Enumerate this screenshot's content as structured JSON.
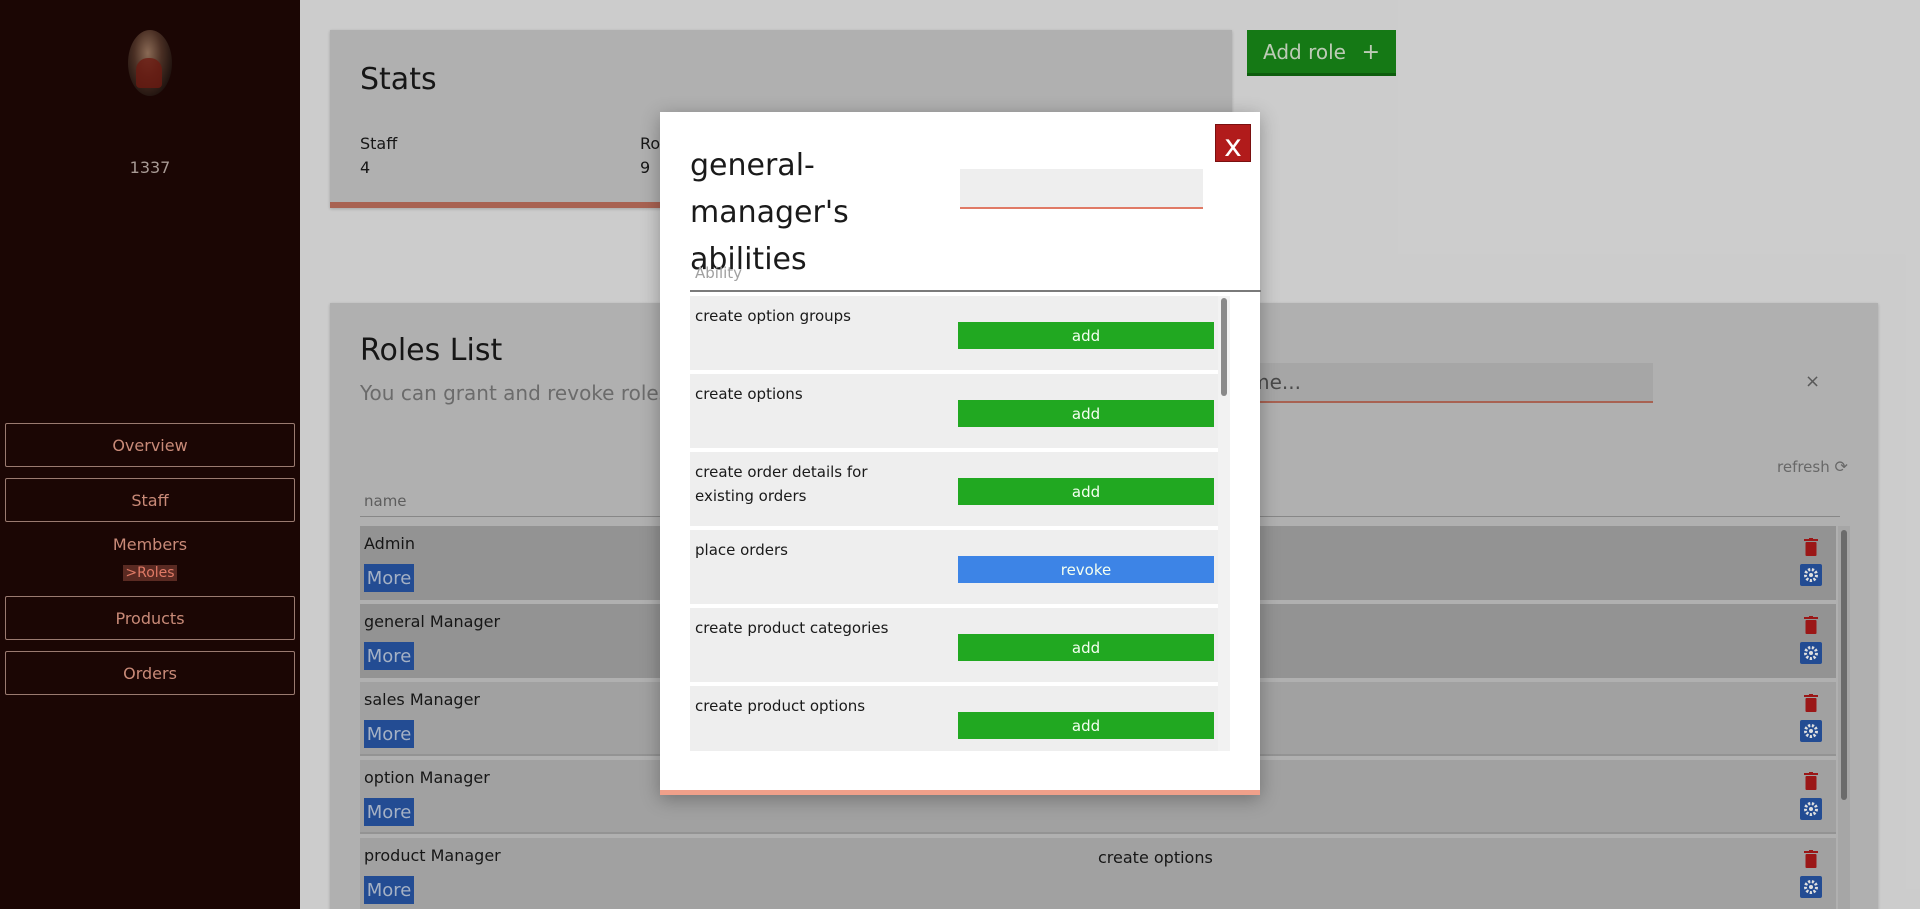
{
  "sidebar": {
    "user_id": "1337",
    "items": [
      {
        "label": "Overview"
      },
      {
        "label": "Staff"
      },
      {
        "label": "Members"
      },
      {
        "label": ">Roles"
      },
      {
        "label": "Products"
      },
      {
        "label": "Orders"
      }
    ]
  },
  "stats": {
    "title": "Stats",
    "items": [
      {
        "label": "Staff",
        "value": "4"
      },
      {
        "label": "Ro",
        "value": "9"
      }
    ]
  },
  "add_role": {
    "label": "Add role",
    "icon": "+"
  },
  "roles": {
    "title": "Roles List",
    "subtitle": "You can grant and revoke roles t",
    "search_placeholder": "ct name...",
    "clear": "×",
    "refresh_label": "refresh",
    "column_name": "name",
    "more_label": "More",
    "rows": [
      {
        "name": "Admin",
        "perm": ""
      },
      {
        "name": "general Manager",
        "perm": ""
      },
      {
        "name": "sales Manager",
        "perm": ""
      },
      {
        "name": "option Manager",
        "perm": ""
      },
      {
        "name": "product Manager",
        "perm": "create options"
      }
    ]
  },
  "modal": {
    "title": "general-manager's abilities",
    "close": "x",
    "column": "Ability",
    "abilities": [
      {
        "name": "create option groups",
        "action": "add"
      },
      {
        "name": "create options",
        "action": "add"
      },
      {
        "name": "create order details for existing orders",
        "action": "add"
      },
      {
        "name": "place orders",
        "action": "revoke"
      },
      {
        "name": "create product categories",
        "action": "add"
      },
      {
        "name": "create product options",
        "action": "add"
      }
    ]
  },
  "colors": {
    "sidebar_bg": "#1b0604",
    "accent": "#e07a66",
    "add": "#21a821",
    "revoke": "#3d84e6",
    "danger": "#b11b1b"
  }
}
